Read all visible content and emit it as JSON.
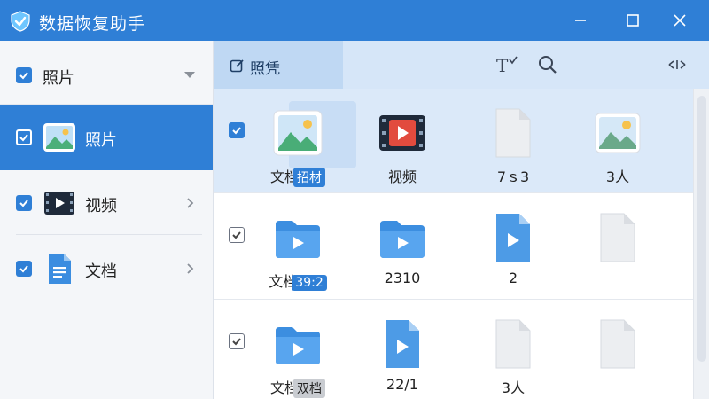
{
  "window": {
    "title": "数据恢复助手",
    "accent": "#2f7fd6"
  },
  "sidebar": {
    "header_label": "照片",
    "items": [
      {
        "label": "照片",
        "icon": "photo-icon",
        "active": true
      },
      {
        "label": "视频",
        "icon": "video-icon",
        "active": false
      },
      {
        "label": "文档",
        "icon": "document-icon",
        "active": false
      }
    ]
  },
  "toolbar": {
    "tab_label": "照凭",
    "text_tool_icon": "text-resize-icon",
    "search_icon": "search-icon",
    "expand_icon": "expand-arrows-icon"
  },
  "grid": {
    "rows": [
      {
        "cells": [
          {
            "icon": "image-file-icon",
            "caption": "文档",
            "badge": "招材"
          },
          {
            "icon": "video-file-icon",
            "caption": "视频",
            "badge": ""
          },
          {
            "icon": "blank-file-icon",
            "caption": "7ｓ3",
            "badge": ""
          },
          {
            "icon": "image-file-icon",
            "caption": "3人",
            "badge": ""
          }
        ]
      },
      {
        "cells": [
          {
            "icon": "video-folder-icon",
            "caption": "文档",
            "badge": "39:2"
          },
          {
            "icon": "video-folder-icon",
            "caption": "2310",
            "badge": ""
          },
          {
            "icon": "video-file-icon",
            "caption": "2",
            "badge": ""
          },
          {
            "icon": "blank-file-icon",
            "caption": "",
            "badge": ""
          }
        ]
      },
      {
        "cells": [
          {
            "icon": "video-folder-icon",
            "caption": "文档",
            "badge": "双档"
          },
          {
            "icon": "video-file-icon",
            "caption": "22/1",
            "badge": ""
          },
          {
            "icon": "blank-file-icon",
            "caption": "3人",
            "badge": ""
          },
          {
            "icon": "blank-file-icon",
            "caption": "",
            "badge": ""
          }
        ]
      }
    ]
  }
}
